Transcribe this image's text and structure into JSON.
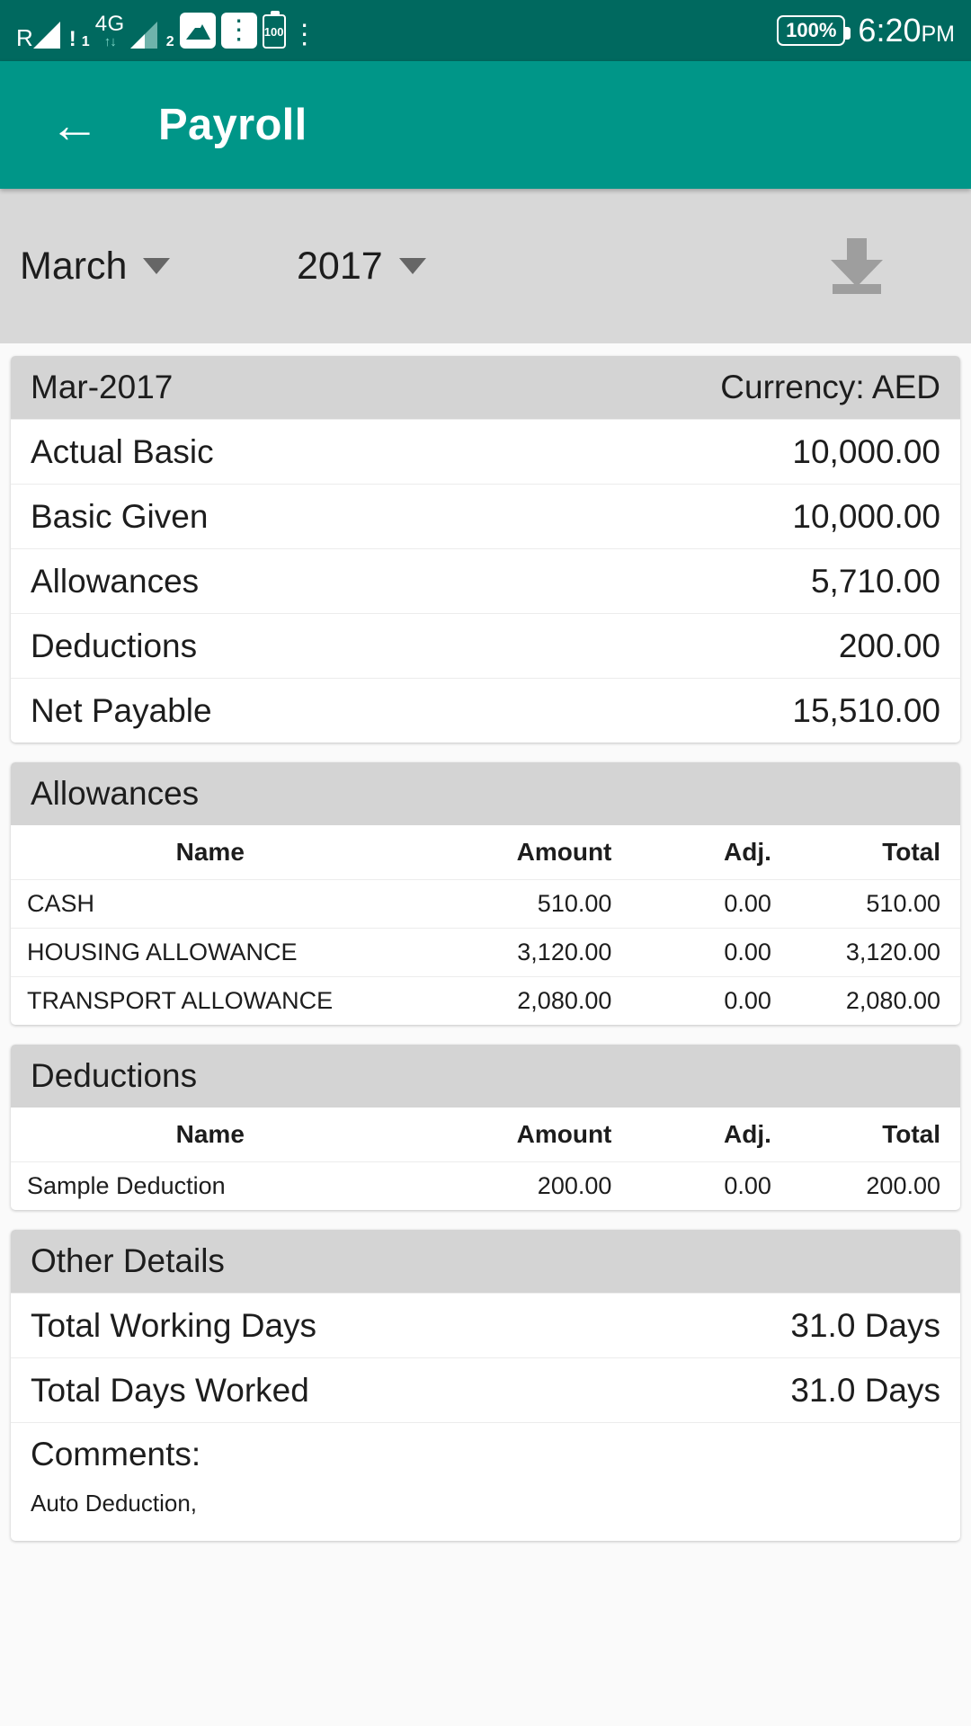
{
  "statusbar": {
    "roaming_label": "R",
    "sim1_alert": "!",
    "sim1_number": "1",
    "network_type": "4G",
    "data_arrows": "↑↓",
    "sim2_number": "2",
    "icons": [
      "image-icon",
      "usb-icon-filled",
      "battery-100-icon",
      "usb-icon-outline"
    ],
    "battery_inline_label": "100",
    "battery_percent": "100%",
    "time": "6:20",
    "ampm": "PM"
  },
  "appbar": {
    "back_icon": "arrow-left-icon",
    "title": "Payroll",
    "color": "#009688"
  },
  "selector": {
    "month": "March",
    "year": "2017",
    "download_icon": "download-icon"
  },
  "summary_card": {
    "period": "Mar-2017",
    "currency": "Currency: AED",
    "rows": [
      {
        "label": "Actual Basic",
        "value": "10,000.00"
      },
      {
        "label": "Basic Given",
        "value": "10,000.00"
      },
      {
        "label": "Allowances",
        "value": "5,710.00"
      },
      {
        "label": "Deductions",
        "value": "200.00"
      },
      {
        "label": "Net Payable",
        "value": "15,510.00"
      }
    ]
  },
  "allowances": {
    "title": "Allowances",
    "columns": [
      "Name",
      "Amount",
      "Adj.",
      "Total"
    ],
    "rows": [
      {
        "name": "CASH",
        "amount": "510.00",
        "adj": "0.00",
        "total": "510.00"
      },
      {
        "name": "HOUSING ALLOWANCE",
        "amount": "3,120.00",
        "adj": "0.00",
        "total": "3,120.00"
      },
      {
        "name": "TRANSPORT ALLOWANCE",
        "amount": "2,080.00",
        "adj": "0.00",
        "total": "2,080.00"
      }
    ]
  },
  "deductions": {
    "title": "Deductions",
    "columns": [
      "Name",
      "Amount",
      "Adj.",
      "Total"
    ],
    "rows": [
      {
        "name": "Sample Deduction",
        "amount": "200.00",
        "adj": "0.00",
        "total": "200.00"
      }
    ]
  },
  "other_details": {
    "title": "Other Details",
    "rows": [
      {
        "label": "Total Working Days",
        "value": "31.0 Days"
      },
      {
        "label": "Total Days Worked",
        "value": "31.0 Days"
      }
    ],
    "comments_label": "Comments:",
    "comments_text": "Auto Deduction,"
  }
}
